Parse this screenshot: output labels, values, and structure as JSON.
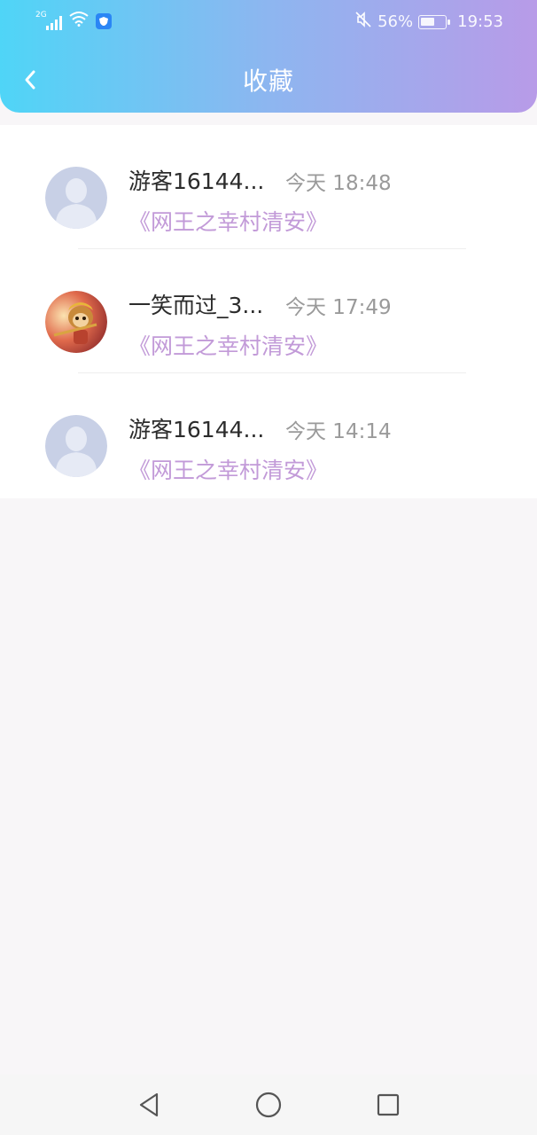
{
  "status_bar": {
    "network_type": "2G",
    "battery_percent": "56%",
    "battery_level": 0.56,
    "time": "19:53"
  },
  "header": {
    "title": "收藏",
    "back_icon": "chevron-left-icon"
  },
  "favorites": [
    {
      "user": "游客16144...",
      "time": "今天 18:48",
      "book": "《网王之幸村清安》",
      "avatar": "default-avatar"
    },
    {
      "user": "一笑而过_3...",
      "time": "今天 17:49",
      "book": "《网王之幸村清安》",
      "avatar": "monkey-king-avatar"
    },
    {
      "user": "游客16144...",
      "time": "今天 14:14",
      "book": "《网王之幸村清安》",
      "avatar": "default-avatar"
    }
  ],
  "nav": {
    "back": "triangle-back-icon",
    "home": "circle-home-icon",
    "recent": "square-recent-icon"
  },
  "colors": {
    "header_gradient": [
      "#4fd5f7",
      "#8db6f0",
      "#b89be8"
    ],
    "book_link": "#c29ad8",
    "time_text": "#9a9a9a",
    "page_bg": "#f8f6f8"
  }
}
